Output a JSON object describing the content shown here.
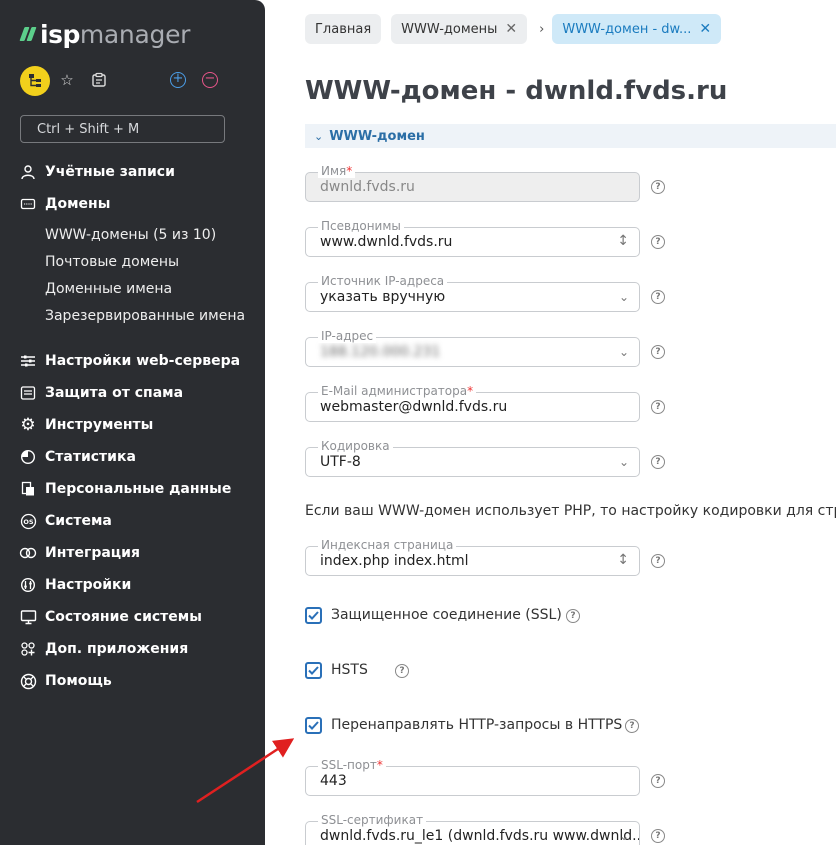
{
  "sidebar": {
    "logo_bold": "isp",
    "logo_light": "manager",
    "search_placeholder": "Ctrl + Shift + M",
    "nav": [
      {
        "label": "Учётные записи",
        "icon": "users-icon"
      },
      {
        "label": "Домены",
        "icon": "domain-icon"
      },
      {
        "label": "Настройки web-сервера",
        "icon": "sliders-icon"
      },
      {
        "label": "Защита от спама",
        "icon": "spam-icon"
      },
      {
        "label": "Инструменты",
        "icon": "gear-icon"
      },
      {
        "label": "Статистика",
        "icon": "pie-chart-icon"
      },
      {
        "label": "Персональные данные",
        "icon": "personal-data-icon"
      },
      {
        "label": "Система",
        "icon": "os-icon"
      },
      {
        "label": "Интеграция",
        "icon": "integration-icon"
      },
      {
        "label": "Настройки",
        "icon": "settings-icon"
      },
      {
        "label": "Состояние системы",
        "icon": "monitor-icon"
      },
      {
        "label": "Доп. приложения",
        "icon": "apps-icon"
      },
      {
        "label": "Помощь",
        "icon": "help-icon"
      }
    ],
    "sub": [
      {
        "label": "WWW-домены (5 из 10)"
      },
      {
        "label": "Почтовые домены"
      },
      {
        "label": "Доменные имена"
      },
      {
        "label": "Зарезервированные имена"
      }
    ]
  },
  "breadcrumbs": [
    {
      "label": "Главная"
    },
    {
      "label": "WWW-домены"
    },
    {
      "label": "WWW-домен - dw..."
    }
  ],
  "page": {
    "title": "WWW-домен - dwnld.fvds.ru"
  },
  "section": {
    "title": "WWW-домен"
  },
  "form": {
    "name": {
      "label": "Имя",
      "value": "dwnld.fvds.ru"
    },
    "aliases": {
      "label": "Псевдонимы",
      "value": "www.dwnld.fvds.ru"
    },
    "ip_source": {
      "label": "Источник IP-адреса",
      "value": "указать вручную"
    },
    "ip": {
      "label": "IP-адрес",
      "value": "188.120.000.231"
    },
    "email": {
      "label": "E-Mail администратора",
      "value": "webmaster@dwnld.fvds.ru"
    },
    "encoding": {
      "label": "Кодировка",
      "value": "UTF-8"
    },
    "info": "Если ваш WWW-домен использует PHP, то настройку кодировки для страниц, об",
    "index": {
      "label": "Индексная страница",
      "value": "index.php index.html"
    },
    "ssl": {
      "label": "Защищенное соединение (SSL)",
      "checked": true
    },
    "hsts": {
      "label": "HSTS",
      "checked": true
    },
    "redirect": {
      "label": "Перенаправлять HTTP-запросы в HTTPS",
      "checked": true
    },
    "ssl_port": {
      "label": "SSL-порт",
      "value": "443"
    },
    "ssl_cert": {
      "label": "SSL-сертификат",
      "value": "dwnld.fvds.ru_le1 (dwnld.fvds.ru www.dwnld..."
    }
  },
  "help_glyph": "?",
  "colors": {
    "sidebar_bg": "#2b2d31",
    "accent": "#2a70b8",
    "logo_green": "#5ccf8b",
    "arrow": "#e02020"
  }
}
